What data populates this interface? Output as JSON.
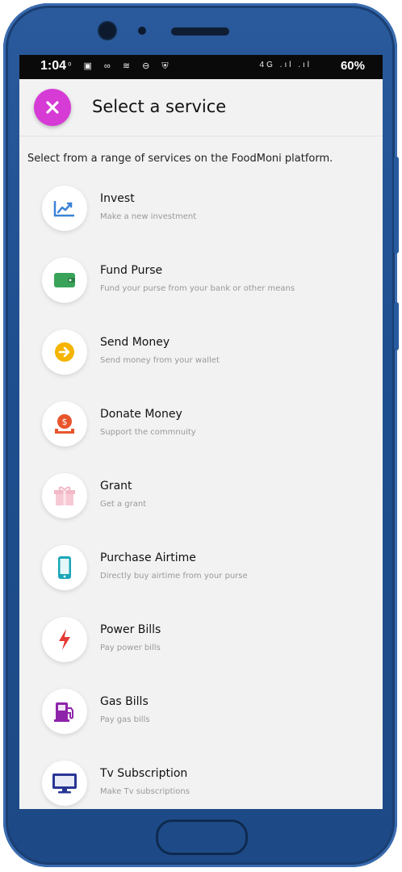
{
  "status_bar": {
    "time": "1:04",
    "icons": "⁰ ▣ ∞ ≋ ⊖ ⛨",
    "network": "4G .ıl .ıl",
    "battery": "60%"
  },
  "header": {
    "close_icon": "✕",
    "title": "Select a service"
  },
  "intro_text": "Select from a range of services on the FoodMoni platform.",
  "services": [
    {
      "title": "Invest",
      "subtitle": "Make a new investment",
      "icon": "chart-icon",
      "color": "#3b82d6"
    },
    {
      "title": "Fund Purse",
      "subtitle": "Fund your purse from your bank or other means",
      "icon": "wallet-icon",
      "color": "#3aa35a"
    },
    {
      "title": "Send Money",
      "subtitle": "Send money from your wallet",
      "icon": "arrow-right-icon",
      "color": "#f5b400"
    },
    {
      "title": "Donate Money",
      "subtitle": "Support the commnuity",
      "icon": "donate-icon",
      "color": "#e8552b"
    },
    {
      "title": "Grant",
      "subtitle": "Get a grant",
      "icon": "gift-icon",
      "color": "#f2b8c6"
    },
    {
      "title": "Purchase Airtime",
      "subtitle": "Directly buy airtime from your purse",
      "icon": "mobile-icon",
      "color": "#1aa6b7"
    },
    {
      "title": "Power Bills",
      "subtitle": "Pay power bills",
      "icon": "lightning-icon",
      "color": "#e53935"
    },
    {
      "title": "Gas Bills",
      "subtitle": "Pay gas bills",
      "icon": "gas-pump-icon",
      "color": "#8e24aa"
    },
    {
      "title": "Tv Subscription",
      "subtitle": "Make Tv subscriptions",
      "icon": "tv-icon",
      "color": "#283593"
    }
  ]
}
